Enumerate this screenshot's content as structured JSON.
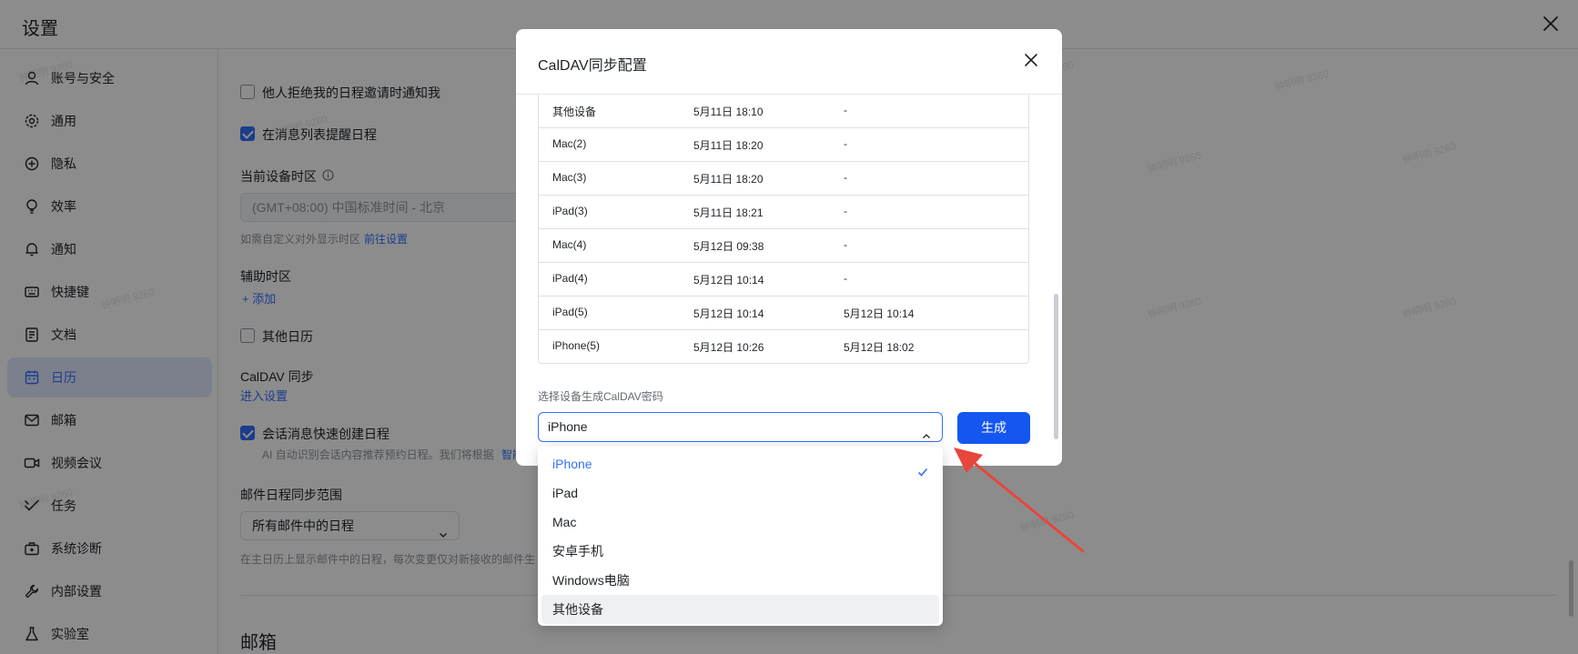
{
  "page": {
    "title": "设置",
    "close_icon": "close-icon"
  },
  "sidebar": {
    "items": [
      {
        "label": "账号与安全",
        "icon": "user-icon"
      },
      {
        "label": "通用",
        "icon": "gear-icon"
      },
      {
        "label": "隐私",
        "icon": "privacy-shield-icon"
      },
      {
        "label": "效率",
        "icon": "lightbulb-icon"
      },
      {
        "label": "通知",
        "icon": "bell-icon"
      },
      {
        "label": "快捷键",
        "icon": "keyboard-icon"
      },
      {
        "label": "文档",
        "icon": "document-icon"
      },
      {
        "label": "日历",
        "icon": "calendar-icon",
        "active": true
      },
      {
        "label": "邮箱",
        "icon": "mail-icon"
      },
      {
        "label": "视频会议",
        "icon": "video-icon"
      },
      {
        "label": "任务",
        "icon": "task-check-icon"
      },
      {
        "label": "系统诊断",
        "icon": "toolbox-icon"
      },
      {
        "label": "内部设置",
        "icon": "wrench-icon"
      },
      {
        "label": "实验室",
        "icon": "flask-icon"
      }
    ]
  },
  "content": {
    "notify_decline": {
      "label": "他人拒绝我的日程邀请时通知我",
      "checked": false
    },
    "remind_in_list": {
      "label": "在消息列表提醒日程",
      "checked": true
    },
    "timezone": {
      "label": "当前设备时区",
      "value": "(GMT+08:00) 中国标准时间 - 北京",
      "hint": "如需自定义对外显示时区",
      "hint_link": "前往设置"
    },
    "aux_timezone": {
      "label": "辅助时区",
      "add_link": "+ 添加"
    },
    "other_calendar": {
      "label": "其他日历",
      "checked": false
    },
    "caldav": {
      "label": "CalDAV 同步",
      "link": "进入设置"
    },
    "quick_create": {
      "label": "会话消息快速创建日程",
      "checked": true,
      "desc": "AI 自动识别会话内容推荐预约日程。我们将根据",
      "desc_link": "智能"
    },
    "mail_sync": {
      "label": "邮件日程同步范围",
      "value": "所有邮件中的日程",
      "desc": "在主日历上显示邮件中的日程，每次变更仅对新接收的邮件生"
    },
    "section_mail": "邮箱"
  },
  "modal": {
    "title": "CalDAV同步配置",
    "close_icon": "close-icon",
    "devices": [
      {
        "name": "其他设备",
        "created": "5月11日 18:10",
        "last_used": "-"
      },
      {
        "name": "Mac(2)",
        "created": "5月11日 18:20",
        "last_used": "-"
      },
      {
        "name": "Mac(3)",
        "created": "5月11日 18:20",
        "last_used": "-"
      },
      {
        "name": "iPad(3)",
        "created": "5月11日 18:21",
        "last_used": "-"
      },
      {
        "name": "Mac(4)",
        "created": "5月12日 09:38",
        "last_used": "-"
      },
      {
        "name": "iPad(4)",
        "created": "5月12日 10:14",
        "last_used": "-"
      },
      {
        "name": "iPad(5)",
        "created": "5月12日 10:14",
        "last_used": "5月12日 10:14"
      },
      {
        "name": "iPhone(5)",
        "created": "5月12日 10:26",
        "last_used": "5月12日 18:02"
      }
    ],
    "select_label": "选择设备生成CalDAV密码",
    "selected_device": "iPhone",
    "generate_label": "生成",
    "options": [
      {
        "label": "iPhone",
        "selected": true
      },
      {
        "label": "iPad"
      },
      {
        "label": "Mac"
      },
      {
        "label": "安卓手机"
      },
      {
        "label": "Windows电脑"
      },
      {
        "label": "其他设备",
        "hovered": true
      }
    ]
  },
  "watermark": "钟明明 9260",
  "colors": {
    "accent": "#3370ff",
    "primary_button": "#1456f0",
    "arrow": "#e8453c",
    "overlay": "rgba(0,0,0,0.45)"
  }
}
